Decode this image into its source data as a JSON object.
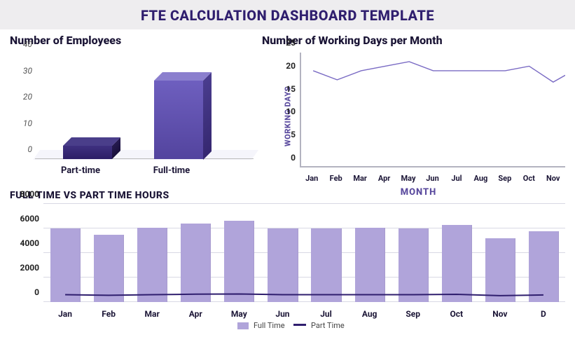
{
  "header": {
    "title": "FTE CALCULATION DASHBOARD TEMPLATE"
  },
  "employees_chart": {
    "title": "Number of Employees",
    "yticks": [
      0,
      10,
      20,
      30,
      40
    ],
    "categories": [
      "Part-time",
      "Full-time"
    ]
  },
  "workingdays_chart": {
    "title": "Number of Working Days per Month",
    "ylabel": "WORKING DAYS",
    "xlabel": "MONTH",
    "yticks": [
      0,
      5,
      10,
      15,
      20,
      25
    ],
    "categories": [
      "Jan",
      "Feb",
      "Mar",
      "Apr",
      "May",
      "Jun",
      "Jul",
      "Aug",
      "Sep",
      "Oct",
      "Nov"
    ]
  },
  "ftpt_chart": {
    "title": "FULL TIME VS PART TIME HOURS",
    "yticks": [
      0,
      2000,
      4000,
      6000,
      8000
    ],
    "categories": [
      "Jan",
      "Feb",
      "Mar",
      "Apr",
      "May",
      "Jun",
      "Jul",
      "Aug",
      "Sep",
      "Oct",
      "Nov",
      "D"
    ],
    "legend": {
      "fulltime": "Full Time",
      "parttime": "Part Time"
    }
  },
  "chart_data": [
    {
      "type": "bar",
      "title": "Number of Employees",
      "categories": [
        "Part-time",
        "Full-time"
      ],
      "values": [
        5,
        30
      ],
      "ylim": [
        0,
        40
      ]
    },
    {
      "type": "line",
      "title": "Number of Working Days per Month",
      "xlabel": "MONTH",
      "ylabel": "WORKING DAYS",
      "categories": [
        "Jan",
        "Feb",
        "Mar",
        "Apr",
        "May",
        "Jun",
        "Jul",
        "Aug",
        "Sep",
        "Oct",
        "Nov"
      ],
      "values": [
        21,
        19,
        21,
        22,
        23,
        21,
        21,
        21,
        21,
        22,
        18.5
      ],
      "ylim": [
        0,
        25
      ]
    },
    {
      "type": "bar",
      "title": "FULL TIME VS PART TIME HOURS",
      "categories": [
        "Jan",
        "Feb",
        "Mar",
        "Apr",
        "May",
        "Jun",
        "Jul",
        "Aug",
        "Sep",
        "Oct",
        "Nov",
        "Dec"
      ],
      "series": [
        {
          "name": "Full Time",
          "values": [
            6000,
            5500,
            6050,
            6400,
            6650,
            6000,
            6000,
            6050,
            6000,
            6300,
            5200,
            5800
          ]
        },
        {
          "name": "Part Time",
          "values": [
            600,
            550,
            600,
            640,
            660,
            600,
            600,
            600,
            600,
            630,
            520,
            580
          ]
        }
      ],
      "ylim": [
        0,
        8000
      ]
    }
  ]
}
